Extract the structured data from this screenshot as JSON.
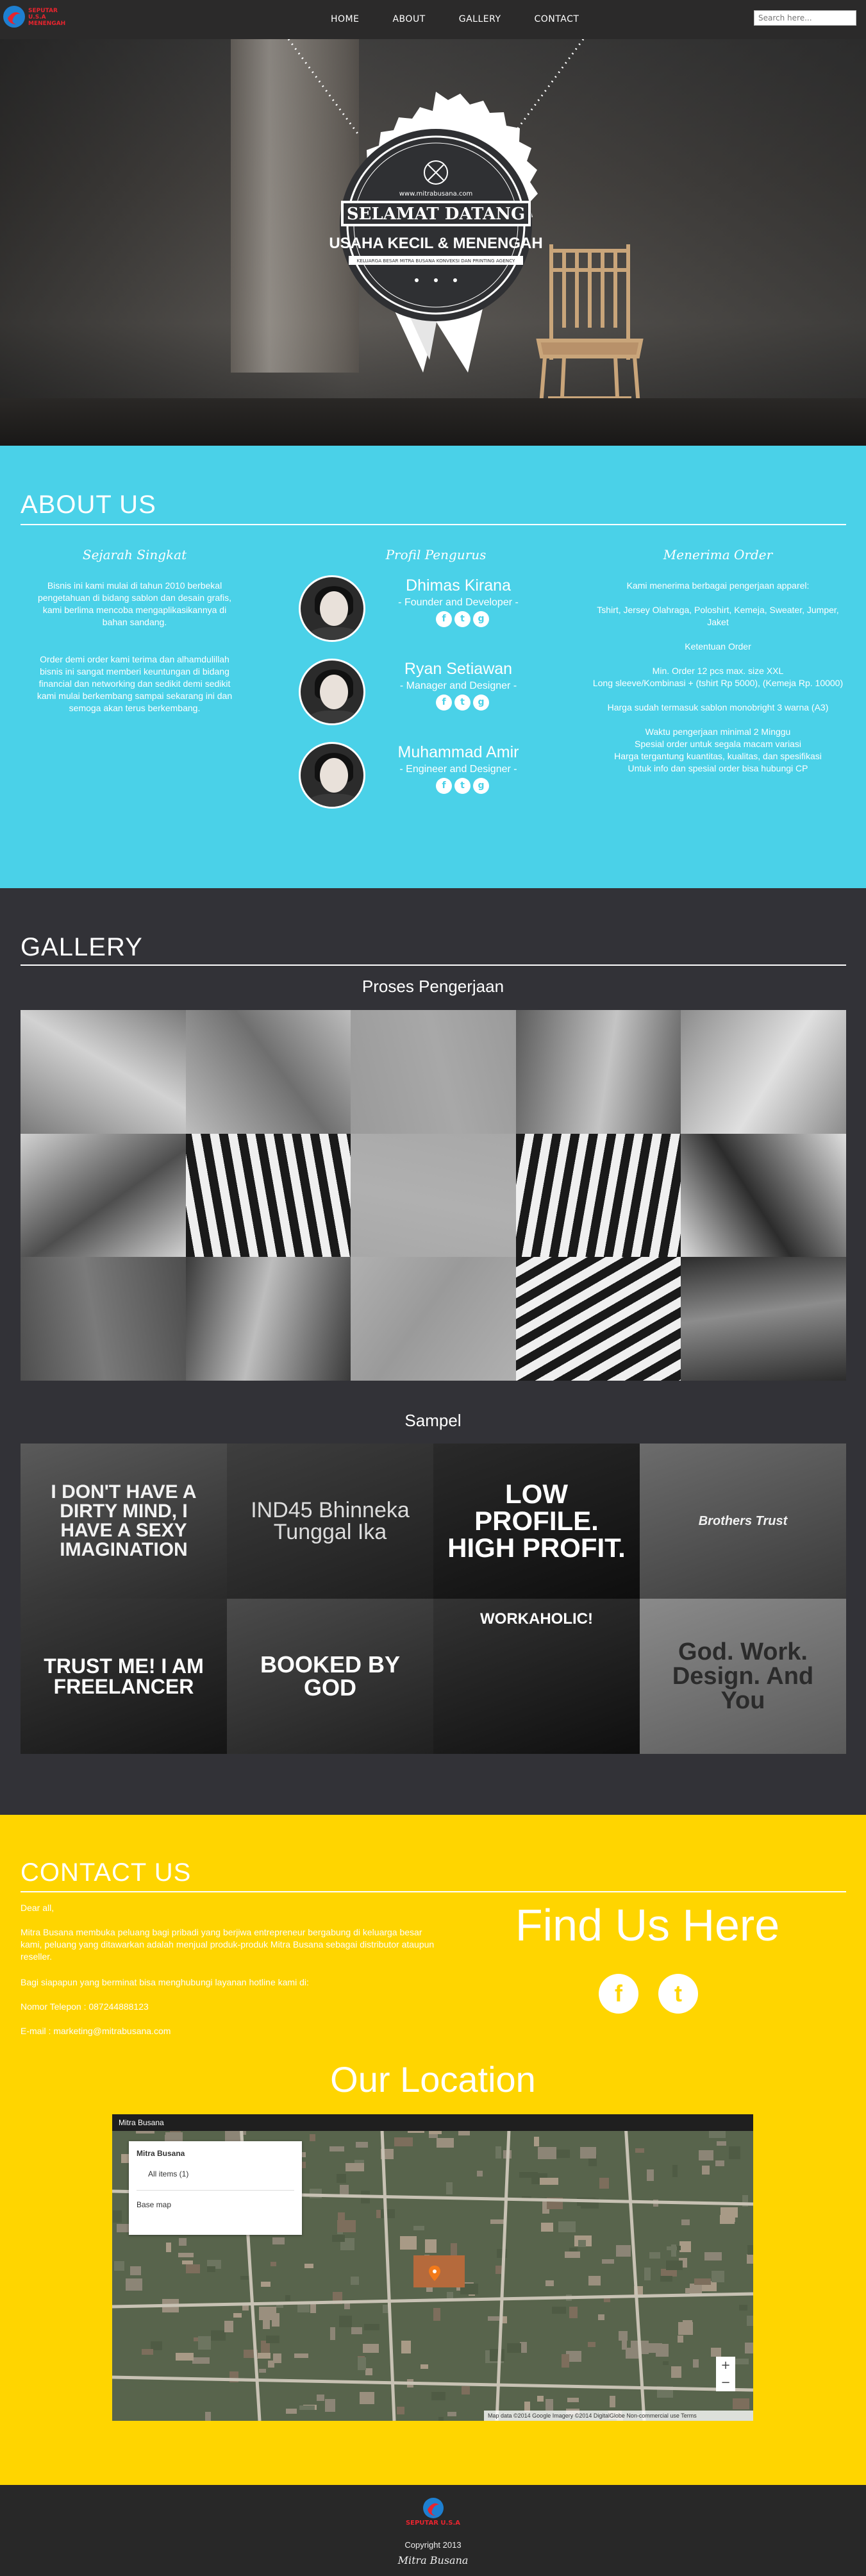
{
  "nav": {
    "logo_lines": [
      "SEPUTAR",
      "U.S.A",
      "MENENGAH"
    ],
    "items": [
      {
        "label": "HOME"
      },
      {
        "label": "ABOUT"
      },
      {
        "label": "GALLERY"
      },
      {
        "label": "CONTACT"
      }
    ],
    "search_placeholder": "Search here..."
  },
  "hero": {
    "badge_url": "www.mitrabusana.com",
    "badge_title": "SELAMAT DATANG",
    "badge_subtitle": "USAHA KECIL & MENENGAH",
    "badge_tagline": "KELUARGA BESAR MITRA BUSANA KONVEKSI DAN PRINTING AGENCY"
  },
  "about": {
    "title": "ABOUT US",
    "col1": {
      "title": "Sejarah Singkat",
      "p1": "Bisnis ini kami mulai di tahun 2010 berbekal pengetahuan di bidang sablon dan desain grafis, kami berlima mencoba mengaplikasikannya di bahan sandang.",
      "p2": "Order demi order kami terima dan alhamdulillah bisnis ini sangat memberi keuntungan di bidang financial dan networking dan sedikit demi sedikit kami mulai berkembang sampai sekarang ini dan semoga akan terus berkembang."
    },
    "col2": {
      "title": "Profil Pengurus",
      "people": [
        {
          "name": "Dhimas Kirana",
          "role": "- Founder and Developer -"
        },
        {
          "name": "Ryan Setiawan",
          "role": "- Manager and Designer -"
        },
        {
          "name": "Muhammad Amir",
          "role": "- Engineer and Designer -"
        }
      ],
      "social": [
        "f",
        "t",
        "g"
      ]
    },
    "col3": {
      "title": "Menerima Order",
      "p1": "Kami menerima berbagai pengerjaan apparel:",
      "p2": "Tshirt, Jersey Olahraga, Poloshirt, Kemeja, Sweater, Jumper, Jaket",
      "p3": "Ketentuan Order",
      "p4": "Min. Order 12 pcs max. size XXL",
      "p5": "Long sleeve/Kombinasi + (tshirt Rp 5000), (Kemeja Rp. 10000)",
      "p6": "Harga sudah termasuk sablon monobright 3 warna (A3)",
      "p7": "Waktu pengerjaan minimal 2 Minggu",
      "p8": "Spesial order untuk segala macam variasi",
      "p9": "Harga tergantung kuantitas, kualitas, dan spesifikasi",
      "p10": "Untuk info dan spesial order bisa hubungi CP"
    }
  },
  "gallery": {
    "title": "GALLERY",
    "sub1": "Proses Pengerjaan",
    "sub2": "Sampel",
    "process_tiles": 15,
    "samples": [
      {
        "text": "I DON'T HAVE A DIRTY MIND, I HAVE A SEXY IMAGINATION"
      },
      {
        "text": "IND45 Bhinneka Tunggal Ika"
      },
      {
        "text": "LOW PROFILE. HIGH PROFIT."
      },
      {
        "text": "Brothers Trust"
      },
      {
        "text": "TRUST ME! I AM FREELANCER"
      },
      {
        "text": "BOOKED BY GOD"
      },
      {
        "text": "WORKAHOLIC!"
      },
      {
        "text": "God. Work. Design. And You"
      }
    ]
  },
  "contact": {
    "title": "CONTACT US",
    "greeting": "Dear all,",
    "p1": "Mitra Busana membuka peluang bagi pribadi yang berjiwa entrepreneur bergabung di keluarga besar kami, peluang yang ditawarkan adalah menjual produk-produk Mitra Busana sebagai distributor ataupun reseller.",
    "p2": "Bagi siapapun yang berminat bisa menghubungi layanan hotline kami di:",
    "phone": "Nomor Telepon : 087244888123",
    "email": "E-mail : marketing@mitrabusana.com",
    "find": "Find Us Here",
    "social": [
      "f",
      "t"
    ],
    "location": "Our Location",
    "map": {
      "title": "Mitra Busana",
      "layer": "Mitra Busana",
      "items": "All items (1)",
      "base": "Base map",
      "attribution": "Map data ©2014 Google Imagery ©2014 DigitalGlobe   Non-commercial use   Terms"
    }
  },
  "footer": {
    "logo_text": "SEPUTAR U.S.A",
    "copyright": "Copyright 2013",
    "signature": "Mitra Busana"
  }
}
